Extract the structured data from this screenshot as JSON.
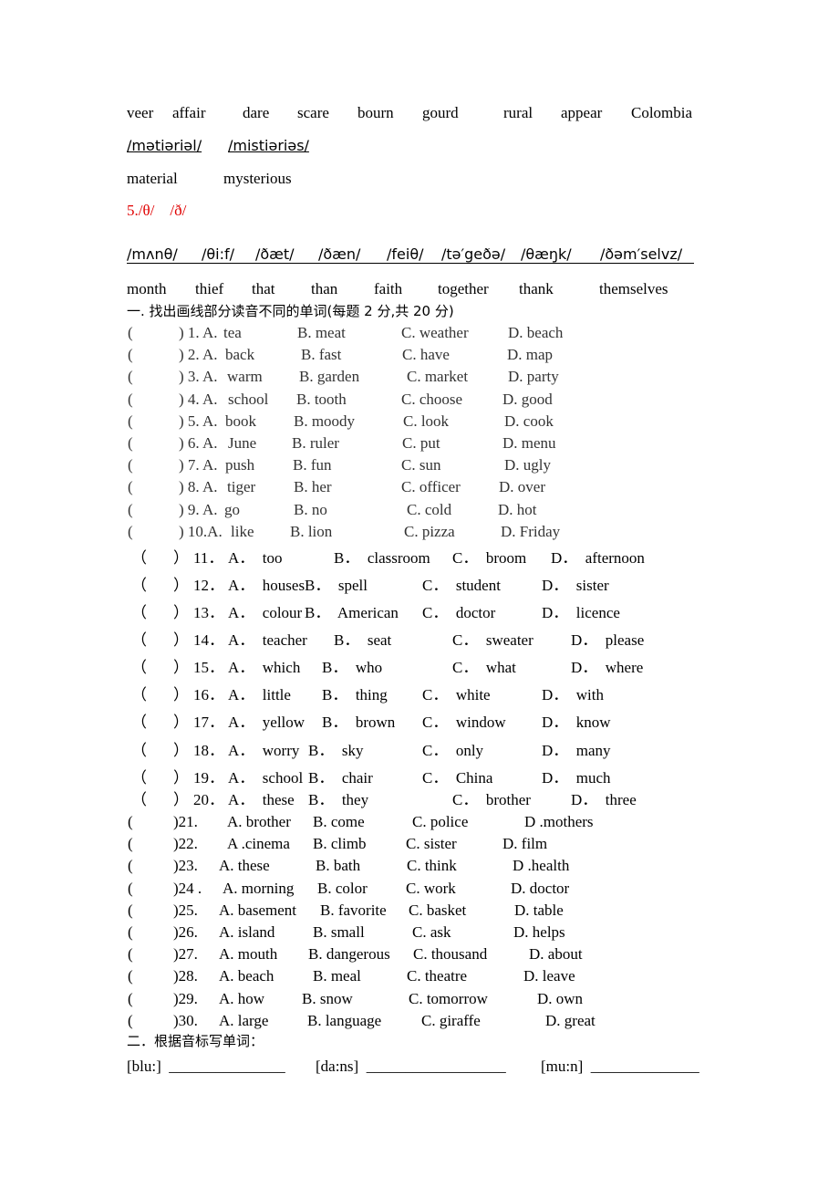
{
  "vocab_line": [
    "veer",
    "affair",
    "dare",
    "scare",
    "bourn",
    "gourd",
    "rural",
    "appear",
    "Colombia"
  ],
  "ipa_line1": [
    "/mətiəriəl/",
    "/mistiəriəs/"
  ],
  "word_line1": [
    "material",
    "mysterious"
  ],
  "section5_heading": "5./θ/    /ð/",
  "ipa_line2": [
    "/mʌnθ/",
    "/θi:f/",
    "/ðæt/",
    "/ðæn/",
    "/feiθ/",
    "/tə′geðə/",
    "/θæŋk/",
    "/ðəm′selvz/"
  ],
  "word_line2": [
    "month",
    "thief",
    "that",
    "than",
    "faith",
    "together",
    "thank",
    "themselves"
  ],
  "part1_title": "一. 找出画线部分读音不同的单词(每题 2 分,共 20 分)",
  "group1": [
    {
      "prefix": ") 1. A.",
      "a": "tea",
      "b": "B. meat",
      "c": "C. weather",
      "d": "D. beach"
    },
    {
      "prefix": ") 2. A.",
      "a": "back",
      "b": "B. fast",
      "c": "C. have",
      "d": "D. map"
    },
    {
      "prefix": ") 3. A.",
      "a": "warm",
      "b": "B. garden",
      "c": "C. market",
      "d": "D. party"
    },
    {
      "prefix": ") 4. A.",
      "a": "school",
      "b": "B. tooth",
      "c": "C. choose",
      "d": "D. good"
    },
    {
      "prefix": ") 5. A.",
      "a": "book",
      "b": "B. moody",
      "c": "C. look",
      "d": "D. cook"
    },
    {
      "prefix": ") 6. A.",
      "a": "June",
      "b": "B. ruler",
      "c": "C. put",
      "d": "D. menu"
    },
    {
      "prefix": ") 7. A.",
      "a": "push",
      "b": "B. fun",
      "c": "C. sun",
      "d": "D. ugly"
    },
    {
      "prefix": ") 8. A.",
      "a": "tiger",
      "b": "B. her",
      "c": "C. officer",
      "d": "D. over"
    },
    {
      "prefix": ") 9. A.",
      "a": "go",
      "b": "B. no",
      "c": "C. cold",
      "d": "D. hot"
    },
    {
      "prefix": ") 10.A.",
      "a": "like",
      "b": "B. lion",
      "c": "C. pizza",
      "d": "D. Friday"
    }
  ],
  "group2": [
    {
      "num": "11．",
      "a": "A．  too",
      "b": "B．  classroom",
      "c": "C．  broom",
      "d": "D．  afternoon"
    },
    {
      "num": "12．",
      "a": "A．  houses",
      "b": "B．  spell",
      "c": "C．  student",
      "d": "D．  sister"
    },
    {
      "num": "13．",
      "a": "A．  colour",
      "b": "B．  American",
      "c": "C．  doctor",
      "d": "D．  licence"
    },
    {
      "num": "14．",
      "a": "A．  teacher",
      "b": "B．  seat",
      "c": "C．  sweater",
      "d": "D．  please"
    },
    {
      "num": "15．",
      "a": "A．  which",
      "b": "B．  who",
      "c": "C．  what",
      "d": "D．  where"
    },
    {
      "num": "16．",
      "a": "A．  little",
      "b": "B．  thing",
      "c": "C．  white",
      "d": "D．  with"
    },
    {
      "num": "17．",
      "a": "A．  yellow",
      "b": "B．  brown",
      "c": "C．  window",
      "d": "D．  know"
    },
    {
      "num": "18．",
      "a": "A．  worry",
      "b": "B．  sky",
      "c": "C．  only",
      "d": "D．  many"
    },
    {
      "num": "19．",
      "a": "A．  school",
      "b": "B．  chair",
      "c": "C．  China",
      "d": "D．  much"
    },
    {
      "num": "20．",
      "a": "A．  these",
      "b": "B．  they",
      "c": "C．  brother",
      "d": "D．  three"
    }
  ],
  "group3": [
    {
      "num": ")21.",
      "a": "A. brother",
      "b": "B. come",
      "c": "C. police",
      "d": "D .mothers"
    },
    {
      "num": ")22.",
      "a": "A .cinema",
      "b": "B. climb",
      "c": "C. sister",
      "d": "D. film"
    },
    {
      "num": ")23.",
      "a": "A. these",
      "b": "B. bath",
      "c": "C. think",
      "d": "D .health"
    },
    {
      "num": ")24 .",
      "a": "A. morning",
      "b": "B. color",
      "c": "C. work",
      "d": "D. doctor"
    },
    {
      "num": ")25.",
      "a": "A. basement",
      "b": "B. favorite",
      "c": "C. basket",
      "d": "D. table"
    },
    {
      "num": ")26.",
      "a": "A. island",
      "b": "B. small",
      "c": "C. ask",
      "d": "D. helps"
    },
    {
      "num": ")27.",
      "a": "A. mouth",
      "b": "B. dangerous",
      "c": "C. thousand",
      "d": "D. about"
    },
    {
      "num": ")28.",
      "a": "A. beach",
      "b": "B. meal",
      "c": "C. theatre",
      "d": "D. leave"
    },
    {
      "num": ")29.",
      "a": "A. how",
      "b": "B. snow",
      "c": "C. tomorrow",
      "d": "D. own"
    },
    {
      "num": ")30.",
      "a": "A. large",
      "b": "B. language",
      "c": "C. giraffe",
      "d": "D. great"
    }
  ],
  "part2_title": "二．根据音标写单词：",
  "part2_items": [
    "[blu:]  _______________",
    "[da:ns]  __________________",
    "[mu:n]  ______________"
  ],
  "paren_open": "(",
  "paren_open_full": "（",
  "paren_close_full": "）"
}
